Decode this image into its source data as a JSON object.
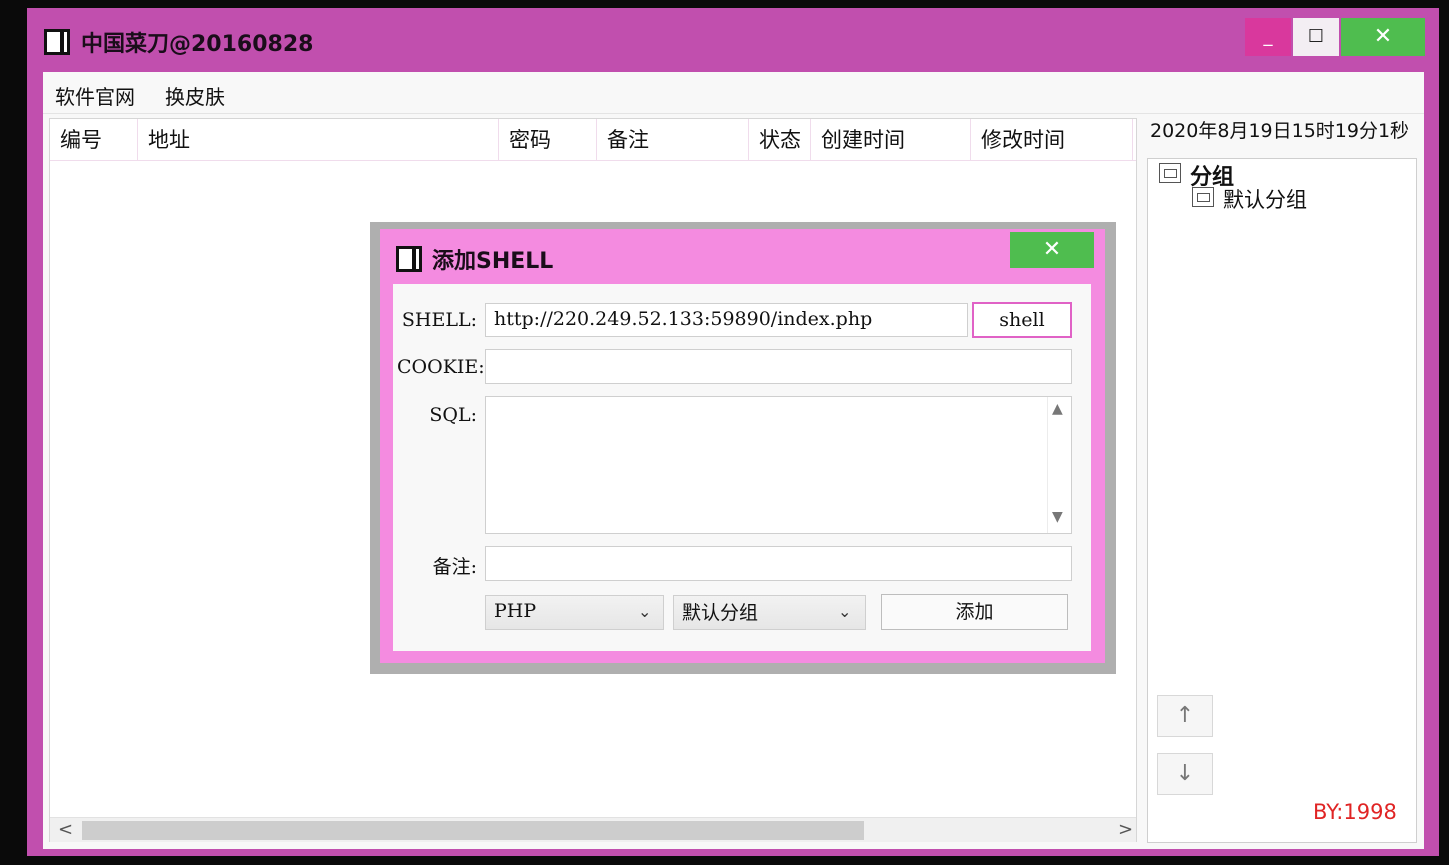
{
  "window": {
    "title": "中国菜刀@20160828",
    "minimize_glyph": "_",
    "maximize_glyph": "☐",
    "close_glyph": "✕"
  },
  "menu": {
    "items": [
      "软件官网",
      "换皮肤"
    ]
  },
  "list": {
    "columns": [
      "编号",
      "地址",
      "密码",
      "备注",
      "状态",
      "创建时间",
      "修改时间"
    ],
    "scroll_left": "<",
    "scroll_right": ">"
  },
  "side": {
    "datetime": "2020年8月19日15时19分1秒",
    "tree": {
      "root": "分组",
      "children": [
        "默认分组"
      ]
    },
    "up_glyph": "↑",
    "down_glyph": "↓",
    "credit": "BY:1998"
  },
  "dialog": {
    "title": "添加SHELL",
    "close_glyph": "✕",
    "shell_label": "SHELL:",
    "shell_value": "http://220.249.52.133:59890/index.php",
    "shell_button": "shell",
    "cookie_label": "COOKIE:",
    "cookie_value": "",
    "sql_label": "SQL:",
    "sql_value": "",
    "note_label": "备注:",
    "note_value": "",
    "type_select": "PHP",
    "group_select": "默认分组",
    "add_button": "添加"
  },
  "icons": {
    "window": "window-icon",
    "tree_node": "tree-node-icon",
    "select_caret": "chevron-down-icon"
  },
  "colors": {
    "frame": "#c14fae",
    "dialog_frame": "#f48be0",
    "close_button": "#4fbd4f",
    "minimize_button": "#d9389d",
    "credit": "#e02424"
  }
}
